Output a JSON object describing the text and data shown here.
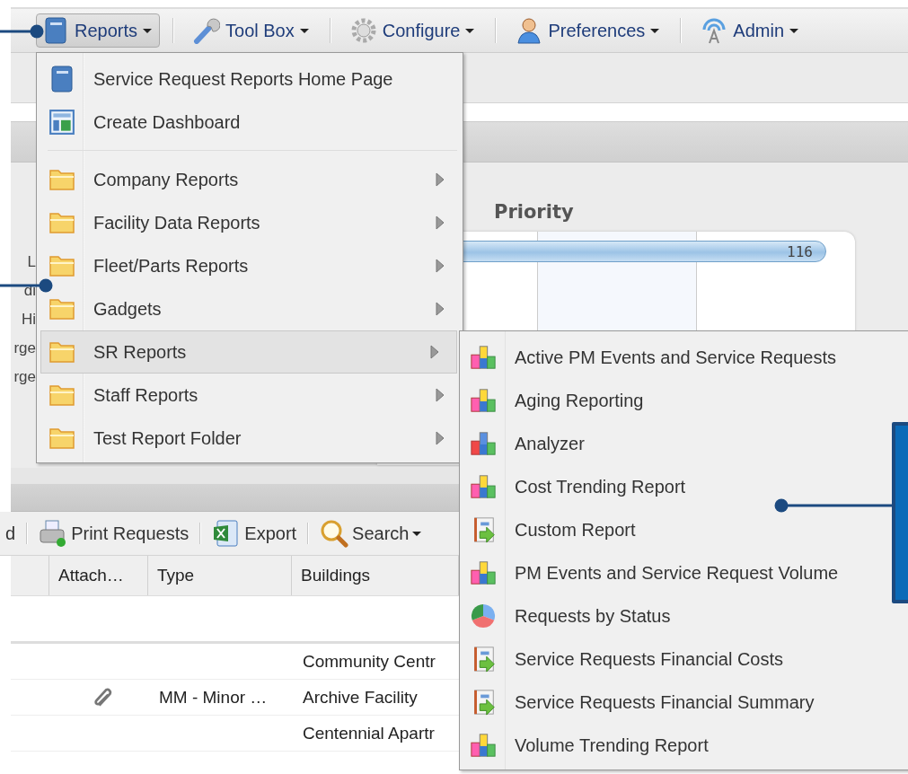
{
  "toolbar": [
    {
      "label": "Reports",
      "selected": true
    },
    {
      "label": "Tool Box",
      "selected": false
    },
    {
      "label": "Configure",
      "selected": false
    },
    {
      "label": "Preferences",
      "selected": false
    },
    {
      "label": "Admin",
      "selected": false
    }
  ],
  "chart": {
    "title": "Priority",
    "bar_label": "116",
    "row_labels": [
      "L",
      "di",
      "Hi",
      "rge",
      "rge"
    ]
  },
  "grid_toolbar": [
    {
      "label": "d",
      "dropdown": false
    },
    {
      "label": "Print Requests",
      "dropdown": false
    },
    {
      "label": "Export",
      "dropdown": false
    },
    {
      "label": "Search",
      "dropdown": true
    }
  ],
  "table": {
    "columns": [
      "Attach…",
      "Type",
      "Buildings"
    ],
    "rows": [
      {
        "attachment": false,
        "building": "Community Centr"
      },
      {
        "attachment": true,
        "type": "MM - Minor …",
        "building": "Archive Facility"
      },
      {
        "attachment": false,
        "building": "Centennial Apartr"
      }
    ]
  },
  "menu": {
    "items": [
      {
        "kind": "link",
        "label": "Service Request Reports Home Page",
        "selected": false
      },
      {
        "kind": "link",
        "label": "Create Dashboard",
        "selected": false
      },
      {
        "kind": "separator"
      },
      {
        "kind": "folder",
        "label": "Company Reports",
        "selected": false
      },
      {
        "kind": "folder",
        "label": "Facility Data Reports",
        "selected": false
      },
      {
        "kind": "folder",
        "label": "Fleet/Parts Reports",
        "selected": false
      },
      {
        "kind": "folder",
        "label": "Gadgets",
        "selected": false
      },
      {
        "kind": "folder",
        "label": "SR Reports",
        "selected": true
      },
      {
        "kind": "folder",
        "label": "Staff Reports",
        "selected": false
      },
      {
        "kind": "folder",
        "label": "Test Report Folder",
        "selected": false
      }
    ]
  },
  "submenu": {
    "items": [
      {
        "kind": "chart",
        "label": "Active PM Events and Service Requests"
      },
      {
        "kind": "chart",
        "label": "Aging Reporting"
      },
      {
        "kind": "analyzer",
        "label": "Analyzer"
      },
      {
        "kind": "chart",
        "label": "Cost Trending Report"
      },
      {
        "kind": "custom",
        "label": "Custom Report"
      },
      {
        "kind": "chart",
        "label": "PM Events and Service Request Volume"
      },
      {
        "kind": "pie",
        "label": "Requests by Status"
      },
      {
        "kind": "custom",
        "label": "Service Requests Financial Costs"
      },
      {
        "kind": "custom",
        "label": "Service Requests Financial Summary"
      },
      {
        "kind": "chart",
        "label": "Volume Trending Report"
      }
    ]
  }
}
